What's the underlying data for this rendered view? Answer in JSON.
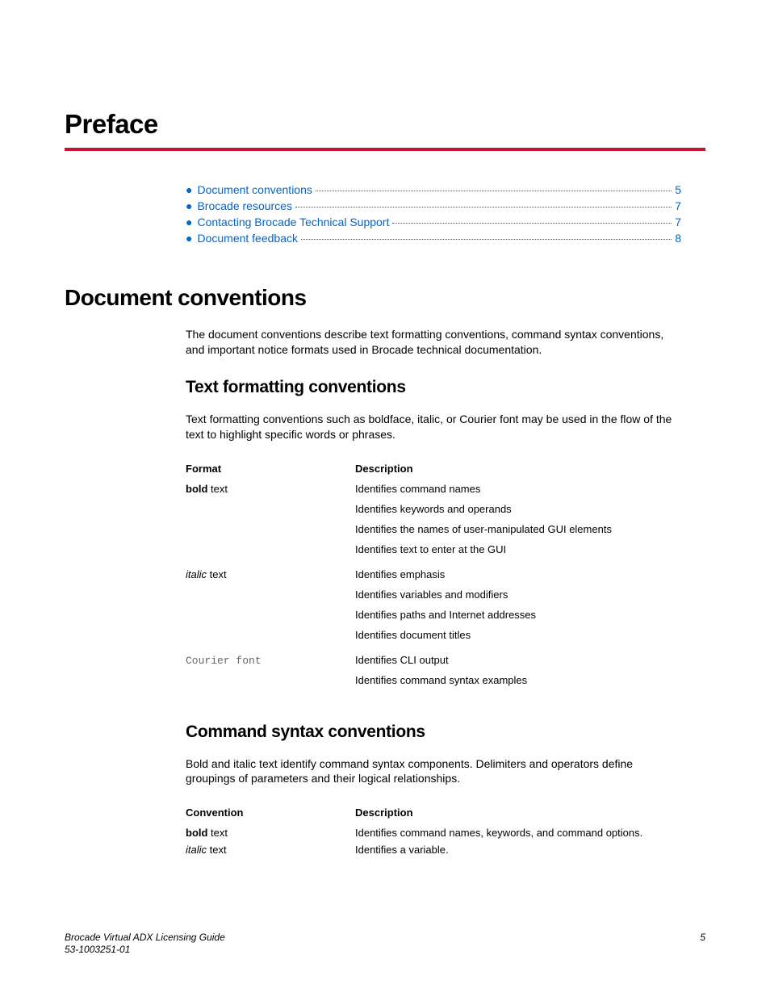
{
  "title": "Preface",
  "toc": [
    {
      "label": "Document conventions",
      "page": "5"
    },
    {
      "label": "Brocade resources",
      "page": "7"
    },
    {
      "label": "Contacting Brocade Technical Support",
      "page": "7"
    },
    {
      "label": "Document feedback",
      "page": "8"
    }
  ],
  "section1": {
    "heading": "Document conventions",
    "intro": "The document conventions describe text formatting conventions, command syntax conventions, and important notice formats used in Brocade technical documentation."
  },
  "sub1": {
    "heading": "Text formatting conventions",
    "intro": "Text formatting conventions such as boldface, italic, or Courier font may be used in the flow of the text to highlight specific words or phrases.",
    "header_format": "Format",
    "header_desc": "Description",
    "rows": [
      {
        "format_prefix": "bold",
        "format_suffix": " text",
        "format_class": "bold",
        "desc": [
          "Identifies command names",
          "Identifies keywords and operands",
          "Identifies the names of user-manipulated GUI elements",
          "Identifies text to enter at the GUI"
        ]
      },
      {
        "format_prefix": "italic",
        "format_suffix": " text",
        "format_class": "italic",
        "desc": [
          "Identifies emphasis",
          "Identifies variables and modifiers",
          "Identifies paths and Internet addresses",
          "Identifies document titles"
        ]
      },
      {
        "format_prefix": "Courier font",
        "format_suffix": "",
        "format_class": "courier",
        "desc": [
          "Identifies CLI output",
          "Identifies command syntax examples"
        ]
      }
    ]
  },
  "sub2": {
    "heading": "Command syntax conventions",
    "intro": "Bold and italic text identify command syntax components. Delimiters and operators define groupings of parameters and their logical relationships.",
    "header_conv": "Convention",
    "header_desc": "Description",
    "rows": [
      {
        "conv_prefix": "bold",
        "conv_suffix": " text",
        "conv_class": "bold",
        "desc": "Identifies command names, keywords, and command options."
      },
      {
        "conv_prefix": "italic",
        "conv_suffix": " text",
        "conv_class": "italic",
        "desc": "Identifies a variable."
      }
    ]
  },
  "footer": {
    "guide": "Brocade Virtual ADX Licensing Guide",
    "docnum": "53-1003251-01",
    "page": "5"
  }
}
